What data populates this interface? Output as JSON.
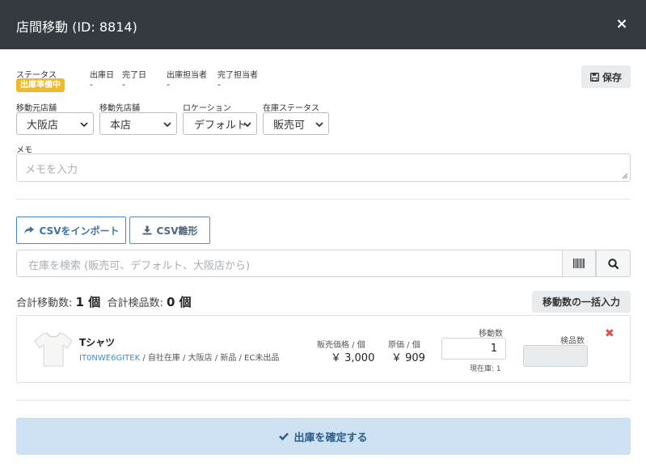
{
  "header": {
    "title": "店間移動 (ID: 8814)",
    "close_label": "×"
  },
  "info": {
    "status_label": "ステータス",
    "status_badge": "出庫準備中",
    "ship_date_label": "出庫日",
    "ship_date_value": "-",
    "done_date_label": "完了日",
    "done_date_value": "-",
    "ship_staff_label": "出庫担当者",
    "ship_staff_value": "-",
    "done_staff_label": "完了担当者",
    "done_staff_value": "-",
    "save_label": "保存"
  },
  "selects": {
    "from_label": "移動元店舗",
    "from_value": "大阪店",
    "to_label": "移動先店舗",
    "to_value": "本店",
    "location_label": "ロケーション",
    "location_value": "デフォルト",
    "stock_status_label": "在庫ステータス",
    "stock_status_value": "販売可"
  },
  "memo": {
    "label": "メモ",
    "placeholder": "メモを入力"
  },
  "actions": {
    "import_csv": "CSVをインポート",
    "csv_template": "CSV雛形"
  },
  "search": {
    "placeholder": "在庫を検索 (販売可、デフォルト、大阪店から)"
  },
  "totals": {
    "move_label": "合計移動数:",
    "move_value": "1 個",
    "inspect_label": "合計検品数:",
    "inspect_value": "0 個",
    "bulk_button": "移動数の一括入力"
  },
  "item": {
    "name": "Tシャツ",
    "sku": "IT0NWE6GITEK",
    "meta": " / 自社在庫 / 大阪店 / 新品 / EC未出品",
    "sale_price_label": "販売価格 / 個",
    "sale_price": "￥ 3,000",
    "cost_label": "原価 / 個",
    "cost": "￥ 909",
    "qty_label": "移動数",
    "qty_value": "1",
    "stock_note": "現在庫: 1",
    "inspect_label": "検品数",
    "remove_label": "✖"
  },
  "confirm": {
    "label": "出庫を確定する"
  },
  "colors": {
    "header_bg": "#343a40",
    "badge": "#f0b929",
    "accent": "#3a73a8",
    "confirm_bg": "#cfe2f3",
    "remove": "#d9534f"
  },
  "icons": [
    "close-icon",
    "save-icon",
    "chevron-down-icon",
    "share-icon",
    "download-icon",
    "barcode-icon",
    "search-icon",
    "tshirt-icon",
    "remove-icon",
    "check-icon"
  ]
}
